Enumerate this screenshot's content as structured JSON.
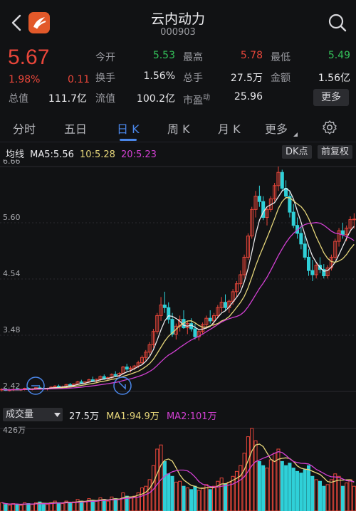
{
  "header": {
    "title": "云内动力",
    "code": "000903"
  },
  "quote": {
    "price": "5.67",
    "change_pct": "1.98%",
    "change": "0.11",
    "rows": [
      [
        {
          "label": "今开",
          "value": "5.53",
          "color": "green"
        },
        {
          "label": "最高",
          "value": "5.78",
          "color": "red"
        },
        {
          "label": "最低",
          "value": "5.49",
          "color": "green"
        }
      ],
      [
        {
          "label": "换手",
          "value": "1.56%",
          "color": "white"
        },
        {
          "label": "总手",
          "value": "27.5万",
          "color": "white"
        },
        {
          "label": "金额",
          "value": "1.56亿",
          "color": "white"
        }
      ],
      [
        {
          "label": "总值",
          "value": "111.7亿",
          "color": "white"
        },
        {
          "label": "流值",
          "value": "100.2亿",
          "color": "white"
        },
        {
          "label": "市盈",
          "label_sup": "动",
          "value": "25.96",
          "color": "white"
        }
      ]
    ],
    "more_label": "更多"
  },
  "tabs": [
    {
      "label": "分时"
    },
    {
      "label": "五日"
    },
    {
      "label": "日 K",
      "active": true
    },
    {
      "label": "周 K"
    },
    {
      "label": "月 K"
    },
    {
      "label": "更多"
    }
  ],
  "ma": {
    "label": "均线",
    "ma5": "MA5:5.56",
    "ma10": "10:5.28",
    "ma20": "20:5.23",
    "dk_label": "DK点",
    "adjust_label": "前复权"
  },
  "price_axis": [
    "6.66",
    "5.60",
    "4.54",
    "3.48",
    "2.42"
  ],
  "volume": {
    "selector_label": "成交量",
    "vol": "27.5万",
    "ma1": "MA1:94.9万",
    "ma2": "MA2:101万",
    "max_label": "426万"
  },
  "colors": {
    "up": "#e8463a",
    "down": "#2fd0d8",
    "ma5": "#e9e9ec",
    "ma10": "#e6d67a",
    "ma20": "#d240d2",
    "accent": "#4a86e8"
  },
  "chart_data": {
    "type": "candlestick",
    "ylim": [
      2.42,
      6.66
    ],
    "candles": [
      [
        2.45,
        2.48,
        2.42,
        2.46
      ],
      [
        2.46,
        2.47,
        2.43,
        2.44
      ],
      [
        2.44,
        2.46,
        2.42,
        2.45
      ],
      [
        2.45,
        2.47,
        2.43,
        2.46
      ],
      [
        2.46,
        2.48,
        2.44,
        2.45
      ],
      [
        2.45,
        2.47,
        2.43,
        2.46
      ],
      [
        2.46,
        2.49,
        2.44,
        2.48
      ],
      [
        2.48,
        2.5,
        2.45,
        2.46
      ],
      [
        2.46,
        2.48,
        2.44,
        2.47
      ],
      [
        2.47,
        2.5,
        2.45,
        2.49
      ],
      [
        2.49,
        2.52,
        2.46,
        2.48
      ],
      [
        2.48,
        2.5,
        2.45,
        2.47
      ],
      [
        2.47,
        2.49,
        2.44,
        2.48
      ],
      [
        2.48,
        2.52,
        2.46,
        2.5
      ],
      [
        2.5,
        2.54,
        2.48,
        2.52
      ],
      [
        2.52,
        2.55,
        2.49,
        2.5
      ],
      [
        2.5,
        2.53,
        2.47,
        2.51
      ],
      [
        2.51,
        2.56,
        2.49,
        2.55
      ],
      [
        2.55,
        2.58,
        2.52,
        2.54
      ],
      [
        2.54,
        2.57,
        2.5,
        2.56
      ],
      [
        2.56,
        2.62,
        2.54,
        2.6
      ],
      [
        2.6,
        2.64,
        2.56,
        2.58
      ],
      [
        2.58,
        2.61,
        2.55,
        2.6
      ],
      [
        2.6,
        2.66,
        2.58,
        2.64
      ],
      [
        2.64,
        2.7,
        2.6,
        2.62
      ],
      [
        2.62,
        2.66,
        2.58,
        2.65
      ],
      [
        2.65,
        2.72,
        2.62,
        2.7
      ],
      [
        2.7,
        2.74,
        2.64,
        2.66
      ],
      [
        2.66,
        2.7,
        2.62,
        2.68
      ],
      [
        2.68,
        2.76,
        2.66,
        2.74
      ],
      [
        2.74,
        2.8,
        2.7,
        2.72
      ],
      [
        2.72,
        2.78,
        2.68,
        2.76
      ],
      [
        2.76,
        2.9,
        2.74,
        2.88
      ],
      [
        2.88,
        2.94,
        2.8,
        2.84
      ],
      [
        2.84,
        2.9,
        2.78,
        2.86
      ],
      [
        2.86,
        2.92,
        2.82,
        2.9
      ],
      [
        2.9,
        3.0,
        2.86,
        2.96
      ],
      [
        2.96,
        3.1,
        2.92,
        3.06
      ],
      [
        3.06,
        3.2,
        3.0,
        3.16
      ],
      [
        3.16,
        3.35,
        3.1,
        3.3
      ],
      [
        3.3,
        3.6,
        3.24,
        3.55
      ],
      [
        3.55,
        3.9,
        3.5,
        3.85
      ],
      [
        3.85,
        4.2,
        3.75,
        4.05
      ],
      [
        4.05,
        4.3,
        3.9,
        4.0
      ],
      [
        4.0,
        4.1,
        3.7,
        3.78
      ],
      [
        3.78,
        3.9,
        3.45,
        3.5
      ],
      [
        3.5,
        3.7,
        3.4,
        3.65
      ],
      [
        3.65,
        3.85,
        3.55,
        3.78
      ],
      [
        3.78,
        3.95,
        3.6,
        3.62
      ],
      [
        3.62,
        3.75,
        3.5,
        3.7
      ],
      [
        3.7,
        3.8,
        3.55,
        3.6
      ],
      [
        3.6,
        3.7,
        3.4,
        3.45
      ],
      [
        3.45,
        3.6,
        3.38,
        3.55
      ],
      [
        3.55,
        3.72,
        3.5,
        3.68
      ],
      [
        3.68,
        3.85,
        3.6,
        3.8
      ],
      [
        3.8,
        3.95,
        3.7,
        3.75
      ],
      [
        3.75,
        3.9,
        3.62,
        3.85
      ],
      [
        3.85,
        4.05,
        3.8,
        4.0
      ],
      [
        4.0,
        4.2,
        3.92,
        4.1
      ],
      [
        4.1,
        4.25,
        3.95,
        4.0
      ],
      [
        4.0,
        4.15,
        3.9,
        4.12
      ],
      [
        4.12,
        4.35,
        4.05,
        4.3
      ],
      [
        4.3,
        4.5,
        4.2,
        4.45
      ],
      [
        4.45,
        4.7,
        4.38,
        4.62
      ],
      [
        4.62,
        5.0,
        4.55,
        4.95
      ],
      [
        4.95,
        5.4,
        4.9,
        5.35
      ],
      [
        5.35,
        5.9,
        5.3,
        5.85
      ],
      [
        5.85,
        6.2,
        5.7,
        6.1
      ],
      [
        6.1,
        6.3,
        5.9,
        6.0
      ],
      [
        6.0,
        6.1,
        5.65,
        5.7
      ],
      [
        5.7,
        5.9,
        5.55,
        5.85
      ],
      [
        5.85,
        6.1,
        5.8,
        6.05
      ],
      [
        6.05,
        6.35,
        6.0,
        6.3
      ],
      [
        6.3,
        6.66,
        6.2,
        6.55
      ],
      [
        6.55,
        6.6,
        6.2,
        6.25
      ],
      [
        6.25,
        6.4,
        6.05,
        6.1
      ],
      [
        6.1,
        6.2,
        5.7,
        5.8
      ],
      [
        5.8,
        5.95,
        5.5,
        5.55
      ],
      [
        5.55,
        5.7,
        5.3,
        5.4
      ],
      [
        5.4,
        5.55,
        5.1,
        5.2
      ],
      [
        5.2,
        5.35,
        4.9,
        4.95
      ],
      [
        4.95,
        5.1,
        4.6,
        4.7
      ],
      [
        4.7,
        4.9,
        4.5,
        4.62
      ],
      [
        4.62,
        4.85,
        4.55,
        4.8
      ],
      [
        4.8,
        4.95,
        4.65,
        4.72
      ],
      [
        4.72,
        4.82,
        4.55,
        4.6
      ],
      [
        4.6,
        4.8,
        4.55,
        4.75
      ],
      [
        4.75,
        5.0,
        4.7,
        4.95
      ],
      [
        4.95,
        5.3,
        4.9,
        5.25
      ],
      [
        5.25,
        5.5,
        5.15,
        5.45
      ],
      [
        5.45,
        5.6,
        5.3,
        5.38
      ],
      [
        5.38,
        5.55,
        5.25,
        5.5
      ],
      [
        5.5,
        5.72,
        5.42,
        5.66
      ],
      [
        5.66,
        5.78,
        5.49,
        5.67
      ]
    ],
    "volumes": [
      0.1,
      0.08,
      0.07,
      0.09,
      0.08,
      0.07,
      0.1,
      0.09,
      0.08,
      0.1,
      0.11,
      0.09,
      0.08,
      0.1,
      0.12,
      0.1,
      0.09,
      0.12,
      0.1,
      0.11,
      0.14,
      0.12,
      0.11,
      0.15,
      0.13,
      0.12,
      0.16,
      0.14,
      0.12,
      0.17,
      0.15,
      0.14,
      0.22,
      0.18,
      0.16,
      0.18,
      0.22,
      0.28,
      0.3,
      0.38,
      0.55,
      0.75,
      0.8,
      0.6,
      0.45,
      0.42,
      0.35,
      0.36,
      0.3,
      0.28,
      0.26,
      0.3,
      0.25,
      0.28,
      0.32,
      0.26,
      0.3,
      0.36,
      0.4,
      0.33,
      0.35,
      0.42,
      0.48,
      0.55,
      0.7,
      0.9,
      1.0,
      0.85,
      0.6,
      0.55,
      0.52,
      0.62,
      0.7,
      0.75,
      0.6,
      0.55,
      0.58,
      0.52,
      0.48,
      0.46,
      0.5,
      0.55,
      0.42,
      0.38,
      0.36,
      0.3,
      0.32,
      0.38,
      0.45,
      0.42,
      0.3,
      0.34,
      0.38,
      0.3
    ],
    "vol_max": 426
  }
}
